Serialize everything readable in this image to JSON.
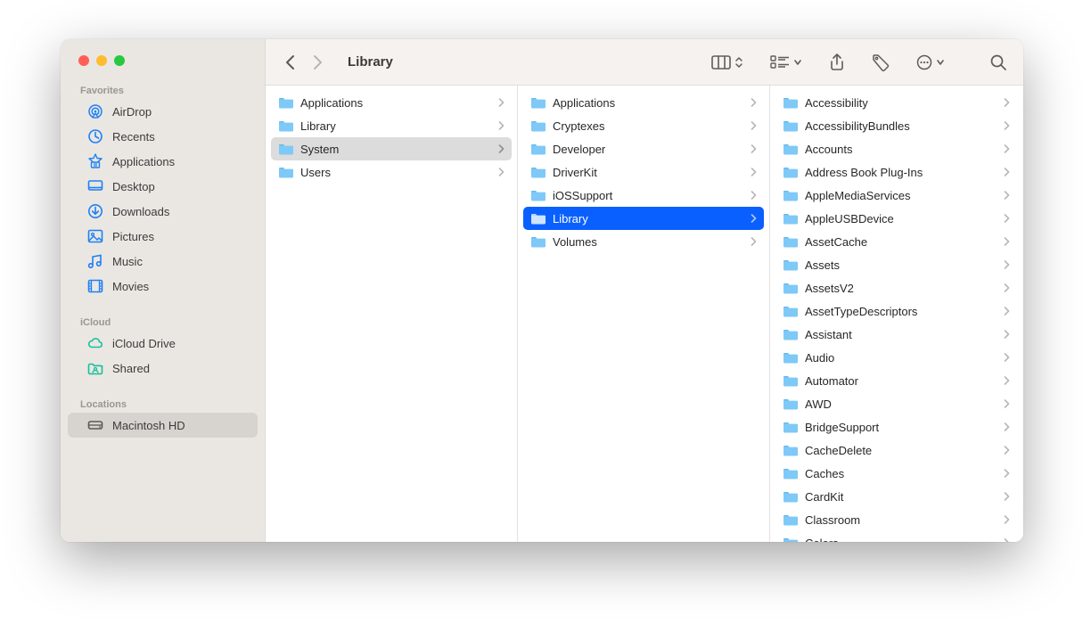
{
  "window_title": "Library",
  "sidebar": {
    "sections": [
      {
        "title": "Favorites",
        "items": [
          {
            "label": "AirDrop",
            "icon": "airdrop"
          },
          {
            "label": "Recents",
            "icon": "clock"
          },
          {
            "label": "Applications",
            "icon": "apps"
          },
          {
            "label": "Desktop",
            "icon": "desktop"
          },
          {
            "label": "Downloads",
            "icon": "download"
          },
          {
            "label": "Pictures",
            "icon": "pictures"
          },
          {
            "label": "Music",
            "icon": "music"
          },
          {
            "label": "Movies",
            "icon": "movies"
          }
        ]
      },
      {
        "title": "iCloud",
        "items": [
          {
            "label": "iCloud Drive",
            "icon": "cloud"
          },
          {
            "label": "Shared",
            "icon": "shared"
          }
        ]
      },
      {
        "title": "Locations",
        "items": [
          {
            "label": "Macintosh HD",
            "icon": "disk",
            "selected": true
          }
        ]
      }
    ]
  },
  "columns": [
    {
      "items": [
        {
          "label": "Applications"
        },
        {
          "label": "Library"
        },
        {
          "label": "System",
          "selected": "gray"
        },
        {
          "label": "Users"
        }
      ]
    },
    {
      "items": [
        {
          "label": "Applications"
        },
        {
          "label": "Cryptexes"
        },
        {
          "label": "Developer"
        },
        {
          "label": "DriverKit"
        },
        {
          "label": "iOSSupport"
        },
        {
          "label": "Library",
          "selected": "blue"
        },
        {
          "label": "Volumes"
        }
      ]
    },
    {
      "items": [
        {
          "label": "Accessibility"
        },
        {
          "label": "AccessibilityBundles"
        },
        {
          "label": "Accounts"
        },
        {
          "label": "Address Book Plug-Ins"
        },
        {
          "label": "AppleMediaServices"
        },
        {
          "label": "AppleUSBDevice"
        },
        {
          "label": "AssetCache"
        },
        {
          "label": "Assets"
        },
        {
          "label": "AssetsV2"
        },
        {
          "label": "AssetTypeDescriptors"
        },
        {
          "label": "Assistant"
        },
        {
          "label": "Audio"
        },
        {
          "label": "Automator"
        },
        {
          "label": "AWD"
        },
        {
          "label": "BridgeSupport"
        },
        {
          "label": "CacheDelete"
        },
        {
          "label": "Caches"
        },
        {
          "label": "CardKit"
        },
        {
          "label": "Classroom"
        },
        {
          "label": "Colors"
        }
      ]
    }
  ]
}
